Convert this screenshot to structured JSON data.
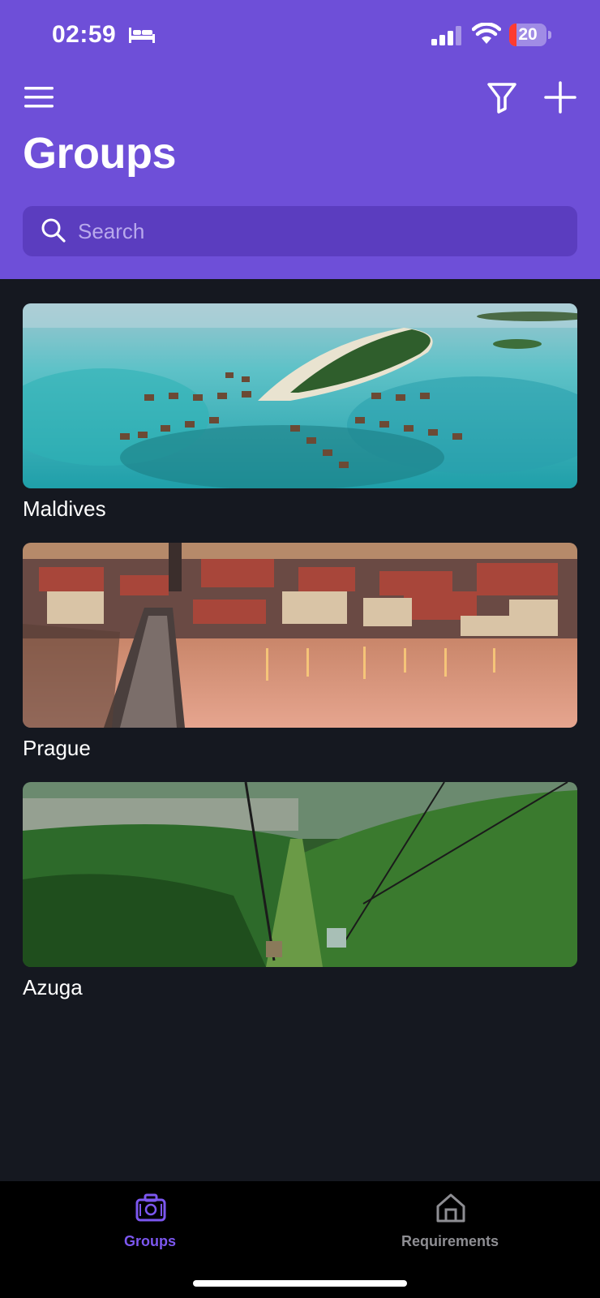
{
  "status_bar": {
    "time": "02:59",
    "battery_level": 20,
    "battery_text": "20",
    "icons": [
      "bed-icon",
      "signal-icon",
      "wifi-icon",
      "battery-icon"
    ]
  },
  "header": {
    "title": "Groups",
    "icons": [
      "menu-icon",
      "filter-icon",
      "add-icon"
    ],
    "search": {
      "placeholder": "Search",
      "value": "",
      "icon": "search-icon"
    }
  },
  "groups": [
    {
      "name": "Maldives",
      "image": "tropical island with overwater bungalows"
    },
    {
      "name": "Prague",
      "image": "city and river at dusk with bridge"
    },
    {
      "name": "Azuga",
      "image": "forested mountain with cable car"
    }
  ],
  "tab_bar": {
    "tabs": [
      {
        "label": "Groups",
        "icon": "suitcase-icon",
        "active": true
      },
      {
        "label": "Requirements",
        "icon": "home-icon",
        "active": false
      }
    ]
  },
  "colors": {
    "accent": "#6e4fd8",
    "search_bg": "#5b3dbf",
    "background": "#151820",
    "tab_active": "#7c57f0",
    "tab_inactive": "#8e8e93",
    "battery_low": "#ff3b30"
  }
}
